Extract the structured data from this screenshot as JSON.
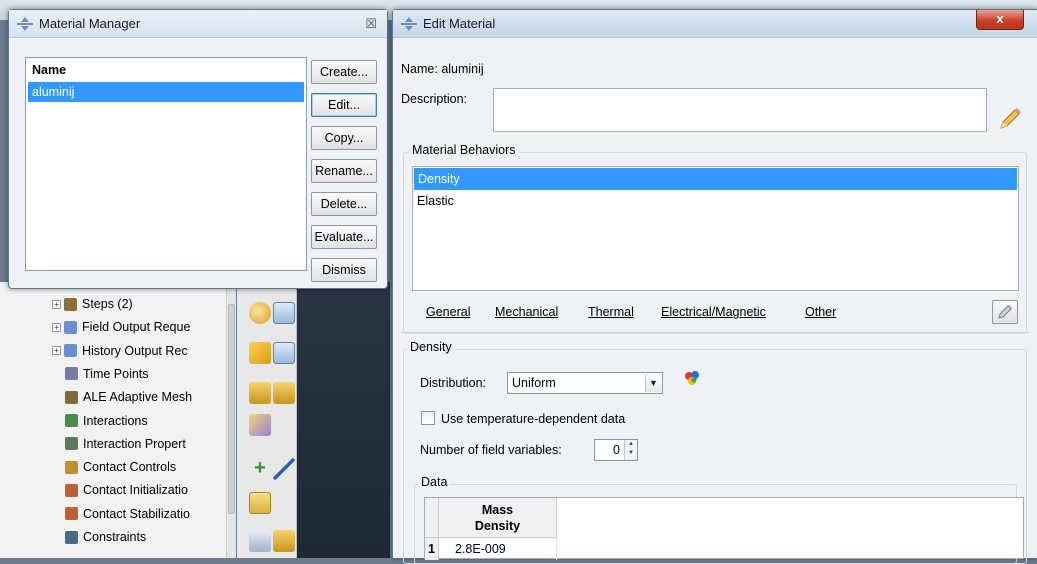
{
  "background_tree": {
    "items": [
      {
        "label": "Steps (2)",
        "expandable": true
      },
      {
        "label": "Field Output Reque",
        "expandable": true
      },
      {
        "label": "History Output Rec",
        "expandable": true
      },
      {
        "label": "Time Points",
        "expandable": false
      },
      {
        "label": "ALE Adaptive Mesh",
        "expandable": false
      },
      {
        "label": "Interactions",
        "expandable": false
      },
      {
        "label": "Interaction Propert",
        "expandable": false
      },
      {
        "label": "Contact Controls",
        "expandable": false
      },
      {
        "label": "Contact Initializatio",
        "expandable": false
      },
      {
        "label": "Contact Stabilizatio",
        "expandable": false
      },
      {
        "label": "Constraints",
        "expandable": false
      }
    ]
  },
  "material_manager": {
    "title": "Material Manager",
    "close_glyph": "☒",
    "list_header": "Name",
    "materials": [
      "aluminij"
    ],
    "buttons": {
      "create": "Create...",
      "edit": "Edit...",
      "copy": "Copy...",
      "rename": "Rename...",
      "delete": "Delete...",
      "evaluate": "Evaluate...",
      "dismiss": "Dismiss"
    }
  },
  "edit_material": {
    "title": "Edit Material",
    "close_glyph": "x",
    "name_label": "Name:",
    "name_value": "aluminij",
    "description_label": "Description:",
    "description_value": "",
    "behaviors_group_label": "Material Behaviors",
    "behaviors": [
      "Density",
      "Elastic"
    ],
    "selected_behavior": "Density",
    "menu": [
      "General",
      "Mechanical",
      "Thermal",
      "Electrical/Magnetic",
      "Other"
    ],
    "section_title": "Density",
    "distribution_label": "Distribution:",
    "distribution_value": "Uniform",
    "temp_dependent_label": "Use temperature-dependent data",
    "temp_dependent_checked": false,
    "field_vars_label": "Number of field variables:",
    "field_vars_value": "0",
    "data_group_label": "Data",
    "table": {
      "columns": [
        "Mass Density"
      ],
      "column_line1": "Mass",
      "column_line2": "Density",
      "rows": [
        {
          "index": "1",
          "values": [
            "2.8E-009"
          ]
        }
      ]
    }
  },
  "colors": {
    "selection": "#3399ff",
    "close_red": "#c8412a",
    "window_bg": "#eef1f5"
  }
}
